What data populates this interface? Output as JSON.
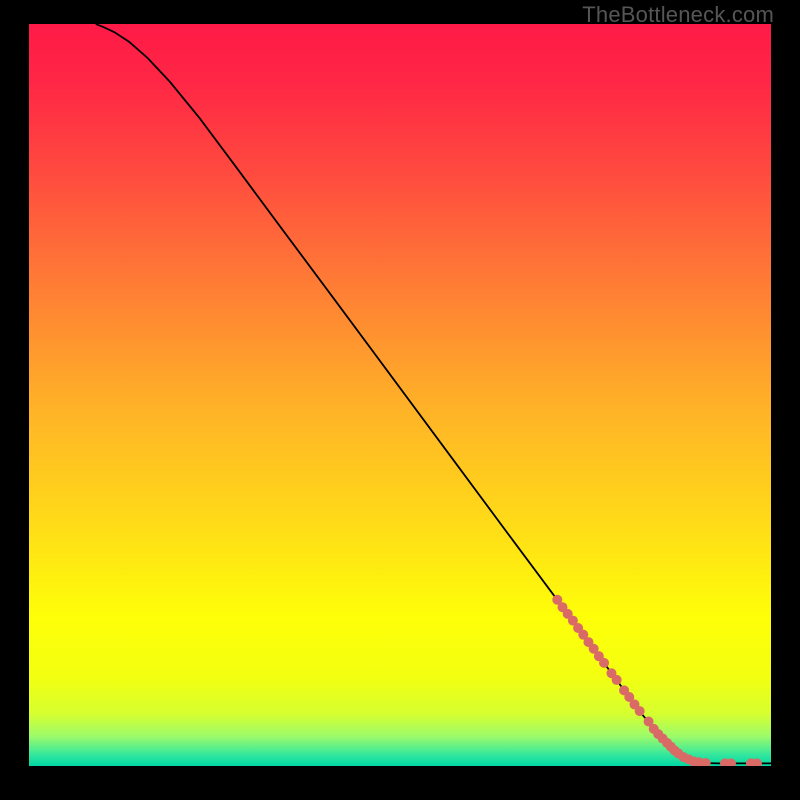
{
  "watermark": "TheBottleneck.com",
  "chart_data": {
    "type": "line",
    "xlim": [
      0,
      100
    ],
    "ylim": [
      0,
      100
    ],
    "title": "",
    "xlabel": "",
    "ylabel": "",
    "gradient_stops": [
      {
        "offset": 0.0,
        "color": "#ff1a47"
      },
      {
        "offset": 0.08,
        "color": "#ff2745"
      },
      {
        "offset": 0.2,
        "color": "#ff4a3f"
      },
      {
        "offset": 0.35,
        "color": "#ff7c35"
      },
      {
        "offset": 0.52,
        "color": "#ffb327"
      },
      {
        "offset": 0.68,
        "color": "#ffdd17"
      },
      {
        "offset": 0.8,
        "color": "#feff08"
      },
      {
        "offset": 0.88,
        "color": "#f3ff10"
      },
      {
        "offset": 0.93,
        "color": "#d6ff30"
      },
      {
        "offset": 0.96,
        "color": "#9cfb6a"
      },
      {
        "offset": 0.985,
        "color": "#33e79e"
      },
      {
        "offset": 1.0,
        "color": "#00d7a3"
      }
    ],
    "series": [
      {
        "name": "curve",
        "color": "#000000",
        "points": [
          {
            "x": 9.0,
            "y": 100.0
          },
          {
            "x": 10.0,
            "y": 99.6
          },
          {
            "x": 11.5,
            "y": 98.9
          },
          {
            "x": 13.5,
            "y": 97.6
          },
          {
            "x": 16.0,
            "y": 95.4
          },
          {
            "x": 19.0,
            "y": 92.2
          },
          {
            "x": 23.0,
            "y": 87.3
          },
          {
            "x": 28.0,
            "y": 80.6
          },
          {
            "x": 34.0,
            "y": 72.5
          },
          {
            "x": 41.0,
            "y": 63.1
          },
          {
            "x": 49.0,
            "y": 52.3
          },
          {
            "x": 57.0,
            "y": 41.5
          },
          {
            "x": 65.0,
            "y": 30.7
          },
          {
            "x": 72.0,
            "y": 21.3
          },
          {
            "x": 78.0,
            "y": 13.2
          },
          {
            "x": 82.5,
            "y": 7.1
          },
          {
            "x": 85.5,
            "y": 3.6
          },
          {
            "x": 87.5,
            "y": 1.7
          },
          {
            "x": 89.0,
            "y": 0.8
          },
          {
            "x": 90.5,
            "y": 0.4
          },
          {
            "x": 93.0,
            "y": 0.35
          },
          {
            "x": 96.0,
            "y": 0.35
          },
          {
            "x": 100.0,
            "y": 0.35
          }
        ]
      }
    ],
    "markers": {
      "color": "#d96a66",
      "radius_px": 5,
      "points": [
        {
          "x": 71.2,
          "y": 22.4
        },
        {
          "x": 71.9,
          "y": 21.4
        },
        {
          "x": 72.6,
          "y": 20.5
        },
        {
          "x": 73.3,
          "y": 19.6
        },
        {
          "x": 74.0,
          "y": 18.6
        },
        {
          "x": 74.7,
          "y": 17.7
        },
        {
          "x": 75.4,
          "y": 16.7
        },
        {
          "x": 76.1,
          "y": 15.8
        },
        {
          "x": 76.8,
          "y": 14.8
        },
        {
          "x": 77.5,
          "y": 13.9
        },
        {
          "x": 78.5,
          "y": 12.5
        },
        {
          "x": 79.2,
          "y": 11.6
        },
        {
          "x": 80.2,
          "y": 10.2
        },
        {
          "x": 80.9,
          "y": 9.3
        },
        {
          "x": 81.6,
          "y": 8.3
        },
        {
          "x": 82.3,
          "y": 7.4
        },
        {
          "x": 83.5,
          "y": 6.0
        },
        {
          "x": 84.2,
          "y": 5.0
        },
        {
          "x": 84.8,
          "y": 4.3
        },
        {
          "x": 85.4,
          "y": 3.7
        },
        {
          "x": 86.0,
          "y": 3.1
        },
        {
          "x": 86.5,
          "y": 2.6
        },
        {
          "x": 87.0,
          "y": 2.1
        },
        {
          "x": 87.5,
          "y": 1.7
        },
        {
          "x": 88.2,
          "y": 1.2
        },
        {
          "x": 88.9,
          "y": 0.9
        },
        {
          "x": 89.6,
          "y": 0.6
        },
        {
          "x": 90.3,
          "y": 0.5
        },
        {
          "x": 91.2,
          "y": 0.4
        },
        {
          "x": 93.8,
          "y": 0.35
        },
        {
          "x": 94.6,
          "y": 0.35
        },
        {
          "x": 97.3,
          "y": 0.35
        },
        {
          "x": 98.1,
          "y": 0.35
        }
      ]
    }
  }
}
